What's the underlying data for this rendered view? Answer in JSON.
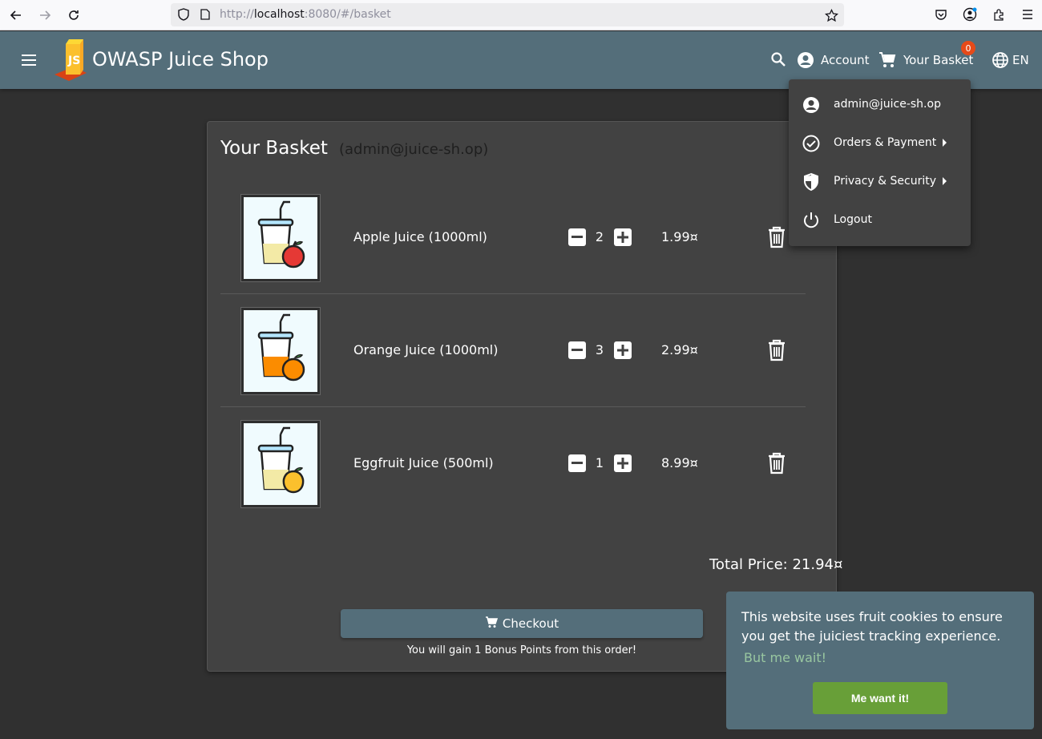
{
  "browser": {
    "url_prefix": "http://",
    "url_host": "localhost",
    "url_rest": ":8080/#/basket"
  },
  "toolbar": {
    "app_title": "OWASP Juice Shop",
    "account_label": "Account",
    "basket_label": "Your Basket",
    "basket_count": "0",
    "language": "EN"
  },
  "basket": {
    "title": "Your Basket",
    "owner": "(admin@juice-sh.op)",
    "items": [
      {
        "name": "Apple Juice (1000ml)",
        "quantity": "2",
        "price": "1.99¤",
        "fruit_color": "#e53935"
      },
      {
        "name": "Orange Juice (1000ml)",
        "quantity": "3",
        "price": "2.99¤",
        "fruit_color": "#fb8c00"
      },
      {
        "name": "Eggfruit Juice (500ml)",
        "quantity": "1",
        "price": "8.99¤",
        "fruit_color": "#fbc02d"
      }
    ],
    "total": "Total Price: 21.94¤",
    "checkout_label": "Checkout",
    "bonus_text": "You will gain 1 Bonus Points from this order!"
  },
  "account_menu": {
    "items": [
      {
        "label": "admin@juice-sh.op",
        "icon": "account-circle-icon",
        "submenu": false
      },
      {
        "label": "Orders & Payment",
        "icon": "check-circle-icon",
        "submenu": true
      },
      {
        "label": "Privacy & Security",
        "icon": "shield-icon",
        "submenu": true
      },
      {
        "label": "Logout",
        "icon": "power-icon",
        "submenu": false
      }
    ]
  },
  "cookie_banner": {
    "message": "This website uses fruit cookies to ensure you get the juiciest tracking experience.",
    "link": "But me wait!",
    "accept": "Me want it!"
  },
  "colors": {
    "toolbar": "#546e7a",
    "background": "#303030",
    "card": "#424242",
    "accept": "#689f38",
    "badge": "#e64a19"
  }
}
